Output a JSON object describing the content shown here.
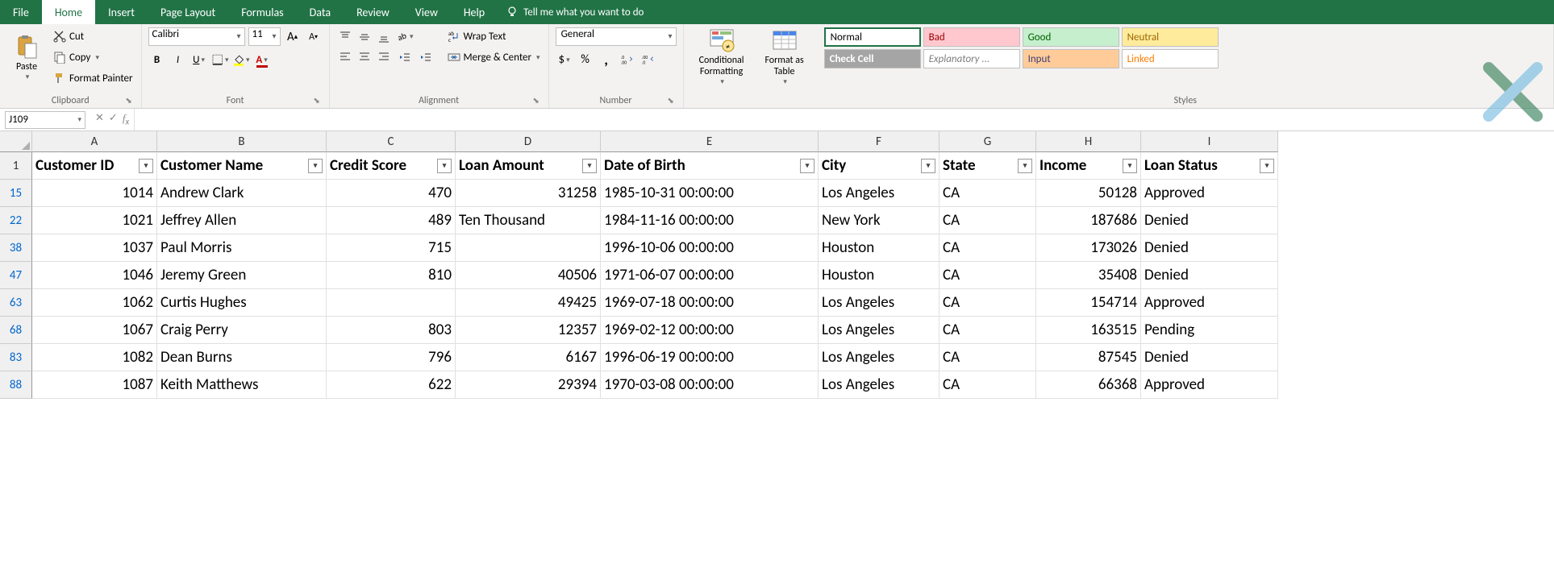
{
  "tabs": [
    "File",
    "Home",
    "Insert",
    "Page Layout",
    "Formulas",
    "Data",
    "Review",
    "View",
    "Help"
  ],
  "active_tab": "Home",
  "tell_me": "Tell me what you want to do",
  "clipboard": {
    "paste": "Paste",
    "cut": "Cut",
    "copy": "Copy",
    "painter": "Format Painter",
    "label": "Clipboard"
  },
  "font": {
    "name": "Calibri",
    "size": "11",
    "label": "Font"
  },
  "alignment": {
    "wrap": "Wrap Text",
    "merge": "Merge & Center",
    "label": "Alignment"
  },
  "number": {
    "format": "General",
    "label": "Number"
  },
  "cond": {
    "cond": "Conditional Formatting",
    "table": "Format as Table"
  },
  "styles": {
    "normal": "Normal",
    "bad": "Bad",
    "good": "Good",
    "neutral": "Neutral",
    "check": "Check Cell",
    "explan": "Explanatory ...",
    "input": "Input",
    "linked": "Linked",
    "label": "Styles"
  },
  "namebox": "J109",
  "columns": [
    "A",
    "B",
    "C",
    "D",
    "E",
    "F",
    "G",
    "H",
    "I"
  ],
  "headers": [
    "Customer ID",
    "Customer Name",
    "Credit Score",
    "Loan Amount",
    "Date of Birth",
    "City",
    "State",
    "Income",
    "Loan Status"
  ],
  "header_row": "1",
  "rows": [
    {
      "n": "15",
      "id": "1014",
      "name": "Andrew Clark",
      "score": "470",
      "loan": "31258",
      "dob": "1985-10-31 00:00:00",
      "city": "Los Angeles",
      "state": "CA",
      "income": "50128",
      "status": "Approved"
    },
    {
      "n": "22",
      "id": "1021",
      "name": "Jeffrey Allen",
      "score": "489",
      "loan": "Ten Thousand",
      "dob": "1984-11-16 00:00:00",
      "city": "New York",
      "state": "CA",
      "income": "187686",
      "status": "Denied"
    },
    {
      "n": "38",
      "id": "1037",
      "name": "Paul Morris",
      "score": "715",
      "loan": "",
      "dob": "1996-10-06 00:00:00",
      "city": "Houston",
      "state": "CA",
      "income": "173026",
      "status": "Denied"
    },
    {
      "n": "47",
      "id": "1046",
      "name": "Jeremy Green",
      "score": "810",
      "loan": "40506",
      "dob": "1971-06-07 00:00:00",
      "city": "Houston",
      "state": "CA",
      "income": "35408",
      "status": "Denied"
    },
    {
      "n": "63",
      "id": "1062",
      "name": "Curtis Hughes",
      "score": "",
      "loan": "49425",
      "dob": "1969-07-18 00:00:00",
      "city": "Los Angeles",
      "state": "CA",
      "income": "154714",
      "status": "Approved"
    },
    {
      "n": "68",
      "id": "1067",
      "name": "Craig Perry",
      "score": "803",
      "loan": "12357",
      "dob": "1969-02-12 00:00:00",
      "city": "Los Angeles",
      "state": "CA",
      "income": "163515",
      "status": "Pending"
    },
    {
      "n": "83",
      "id": "1082",
      "name": "Dean Burns",
      "score": "796",
      "loan": "6167",
      "dob": "1996-06-19 00:00:00",
      "city": "Los Angeles",
      "state": "CA",
      "income": "87545",
      "status": "Denied"
    },
    {
      "n": "88",
      "id": "1087",
      "name": "Keith Matthews",
      "score": "622",
      "loan": "29394",
      "dob": "1970-03-08 00:00:00",
      "city": "Los Angeles",
      "state": "CA",
      "income": "66368",
      "status": "Approved"
    }
  ],
  "loan_text_align": [
    "num",
    "num",
    "",
    "num",
    "num",
    "num",
    "num",
    "num",
    "num"
  ]
}
